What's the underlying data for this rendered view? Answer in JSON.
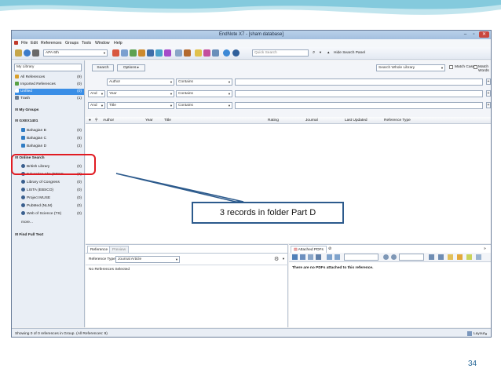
{
  "window": {
    "title": "EndNote X7 - [sham database]",
    "controls": [
      "–",
      "▫",
      "✕"
    ]
  },
  "menu": [
    "File",
    "Edit",
    "References",
    "Groups",
    "Tools",
    "Window",
    "Help"
  ],
  "toolbar": {
    "style": "APA 6th",
    "quick_search_placeholder": "Quick Search",
    "hide_panel_label": "Hide Search Panel"
  },
  "search_panel": {
    "library_scope": "My Library",
    "search_button": "Search",
    "options_button": "Options ▸",
    "scope_dropdown": "Search Whole Library",
    "match_case": "Match Case",
    "match_words": "Match Words",
    "rows": [
      {
        "bool": "",
        "field": "Author",
        "op": "Contains"
      },
      {
        "bool": "And",
        "field": "Year",
        "op": "Contains"
      },
      {
        "bool": "And",
        "field": "Title",
        "op": "Contains"
      }
    ]
  },
  "sidebar": {
    "header": "My Library",
    "library_items": [
      {
        "label": "All References",
        "count": "(9)"
      },
      {
        "label": "Imported References",
        "count": "(0)"
      },
      {
        "label": "Unfiled",
        "count": "(0)"
      },
      {
        "label": "Trash",
        "count": "(1)"
      }
    ],
    "my_groups": "My Groups",
    "group_set": "GXEX1401",
    "groups": [
      {
        "label": "Bahagian B",
        "count": "(0)"
      },
      {
        "label": "Bahagian C",
        "count": "(6)"
      },
      {
        "label": "Bahagian D",
        "count": "(3)"
      }
    ],
    "online_search": "Online Search",
    "online_items": [
      {
        "label": "British Library",
        "count": "(0)"
      },
      {
        "label": "Education Abs (EBSC...",
        "count": "(0)"
      },
      {
        "label": "Library of Congress",
        "count": "(0)"
      },
      {
        "label": "LISTA (EBSCO)",
        "count": "(0)"
      },
      {
        "label": "Project MUSE",
        "count": "(0)"
      },
      {
        "label": "PubMed (NLM)",
        "count": "(0)"
      },
      {
        "label": "Web of Science (TS)",
        "count": "(0)"
      }
    ],
    "more": "more...",
    "find_full_text": "Find Full Text"
  },
  "list_header": [
    "Author",
    "Year",
    "Title",
    "Rating",
    "Journal",
    "Last Updated",
    "Reference Type"
  ],
  "reference_panel": {
    "tabs": [
      "Reference",
      "Preview"
    ],
    "ref_type_label": "Reference Type:",
    "ref_type_value": "Journal Article",
    "no_selection": "No References Selected"
  },
  "pdf_panel": {
    "tab": "Attached PDFs",
    "message": "There are no PDFs attached to this reference."
  },
  "status": {
    "text": "Showing 0 of 0 references in Group. (All References: 9)",
    "layout": "Layout"
  },
  "annotation": {
    "callout": "3 records in folder Part D",
    "page_number": "34"
  },
  "colors": {
    "highlight": "#e11b22",
    "callout_border": "#2c5a8c",
    "selection": "#3a8ee6"
  }
}
